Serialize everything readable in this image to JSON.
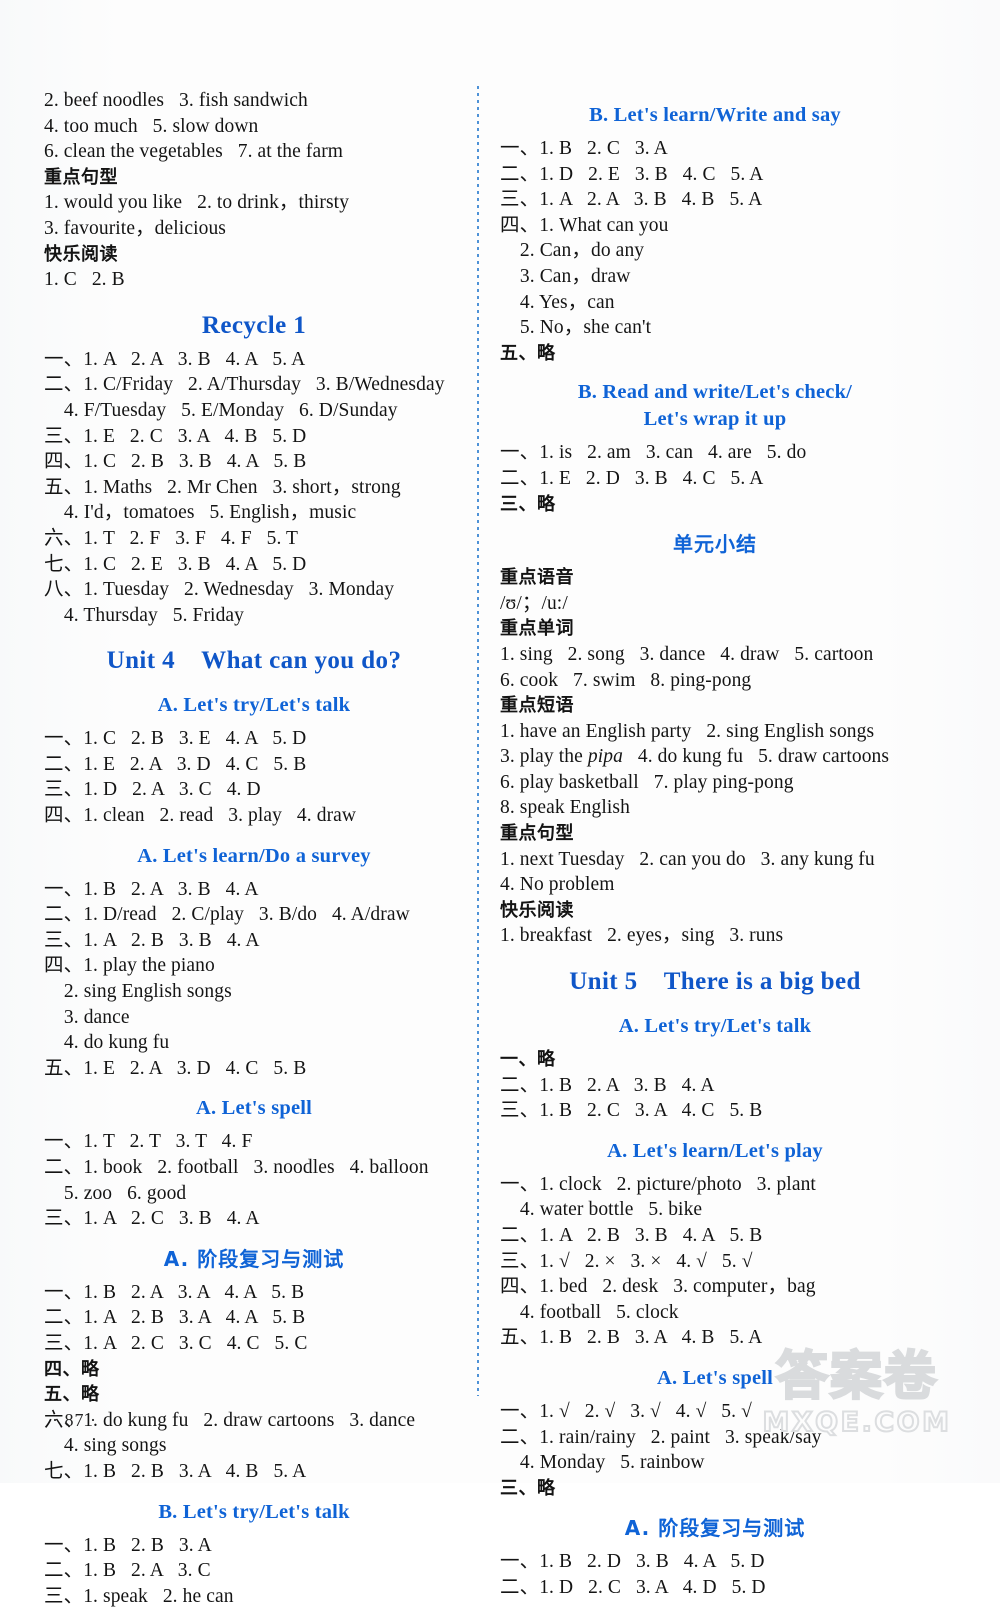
{
  "page": {
    "number": "· 87 ·",
    "watermark_cn": "答案卷",
    "watermark_en": "MXQE.COM"
  },
  "left_column": {
    "blocks": [
      {
        "type": "lines",
        "lines": [
          "2. beef noodles   3. fish sandwich",
          "4. too much   5. slow down",
          "6. clean the vegetables   7. at the farm"
        ]
      },
      {
        "type": "cn-label",
        "text": "重点句型"
      },
      {
        "type": "lines",
        "lines": [
          "1. would you like   2. to drink，thirsty",
          "3. favourite，delicious"
        ]
      },
      {
        "type": "cn-label",
        "text": "快乐阅读"
      },
      {
        "type": "lines",
        "lines": [
          "1. C   2. B"
        ]
      },
      {
        "type": "unit-title",
        "text": "Recycle 1"
      },
      {
        "type": "lines",
        "lines": [
          "一、1. A   2. A   3. B   4. A   5. A",
          "二、1. C/Friday   2. A/Thursday   3. B/Wednesday",
          "    4. F/Tuesday   5. E/Monday   6. D/Sunday",
          "三、1. E   2. C   3. A   4. B   5. D",
          "四、1. C   2. B   3. B   4. A   5. B",
          "五、1. Maths   2. Mr Chen   3. short，strong",
          "    4. I'd，tomatoes   5. English，music",
          "六、1. T   2. F   3. F   4. F   5. T",
          "七、1. C   2. E   3. B   4. A   5. D",
          "八、1. Tuesday   2. Wednesday   3. Monday",
          "    4. Thursday   5. Friday"
        ]
      },
      {
        "type": "unit-title",
        "text": "Unit 4    What can you do?"
      },
      {
        "type": "sec-title",
        "text": "A. Let's try/Let's talk"
      },
      {
        "type": "lines",
        "lines": [
          "一、1. C   2. B   3. E   4. A   5. D",
          "二、1. E   2. A   3. D   4. C   5. B",
          "三、1. D   2. A   3. C   4. D",
          "四、1. clean   2. read   3. play   4. draw"
        ]
      },
      {
        "type": "sec-title",
        "text": "A. Let's learn/Do a survey"
      },
      {
        "type": "lines",
        "lines": [
          "一、1. B   2. A   3. B   4. A",
          "二、1. D/read   2. C/play   3. B/do   4. A/draw",
          "三、1. A   2. B   3. B   4. A",
          "四、1. play the piano",
          "    2. sing English songs",
          "    3. dance",
          "    4. do kung fu",
          "五、1. E   2. A   3. D   4. C   5. B"
        ]
      },
      {
        "type": "sec-title",
        "text": "A. Let's spell"
      },
      {
        "type": "lines",
        "lines": [
          "一、1. T   2. T   3. T   4. F",
          "二、1. book   2. football   3. noodles   4. balloon",
          "    5. zoo   6. good",
          "三、1. A   2. C   3. B   4. A"
        ]
      },
      {
        "type": "sec-title-cn",
        "text": "A. 阶段复习与测试"
      },
      {
        "type": "lines",
        "lines": [
          "一、1. B   2. A   3. A   4. A   5. B",
          "二、1. A   2. B   3. A   4. A   5. B",
          "三、1. A   2. C   3. C   4. C   5. C"
        ]
      },
      {
        "type": "lines-cn",
        "lines": [
          "四、略",
          "五、略"
        ]
      },
      {
        "type": "lines",
        "lines": [
          "六、1. do kung fu   2. draw cartoons   3. dance",
          "    4. sing songs",
          "七、1. B   2. B   3. A   4. B   5. A"
        ]
      },
      {
        "type": "sec-title",
        "text": "B. Let's try/Let's talk"
      },
      {
        "type": "lines",
        "lines": [
          "一、1. B   2. B   3. A",
          "二、1. B   2. A   3. C",
          "三、1. speak   2. he can"
        ]
      }
    ]
  },
  "right_column": {
    "blocks": [
      {
        "type": "sec-title",
        "text": "B. Let's learn/Write and say"
      },
      {
        "type": "lines",
        "lines": [
          "一、1. B   2. C   3. A",
          "二、1. D   2. E   3. B   4. C   5. A",
          "三、1. A   2. A   3. B   4. B   5. A",
          "四、1. What can you",
          "    2. Can，do any",
          "    3. Can，draw",
          "    4. Yes，can",
          "    5. No，she can't"
        ]
      },
      {
        "type": "lines-cn",
        "lines": [
          "五、略"
        ]
      },
      {
        "type": "sec-title",
        "text": "B. Read and write/Let's check/\nLet's wrap it up"
      },
      {
        "type": "lines",
        "lines": [
          "一、1. is   2. am   3. can   4. are   5. do",
          "二、1. E   2. D   3. B   4. C   5. A"
        ]
      },
      {
        "type": "lines-cn",
        "lines": [
          "三、略"
        ]
      },
      {
        "type": "sec-title-cn",
        "text": "单元小结"
      },
      {
        "type": "cn-label",
        "text": "重点语音"
      },
      {
        "type": "lines",
        "lines": [
          "/ʊ/；/u:/"
        ]
      },
      {
        "type": "cn-label",
        "text": "重点单词"
      },
      {
        "type": "lines",
        "lines": [
          "1. sing   2. song   3. dance   4. draw   5. cartoon",
          "6. cook   7. swim   8. ping-pong"
        ]
      },
      {
        "type": "cn-label",
        "text": "重点短语"
      },
      {
        "type": "lines",
        "lines": [
          "1. have an English party   2. sing English songs"
        ]
      },
      {
        "type": "line-italic",
        "pre": "3. play the ",
        "ital": "pipa",
        "post": "   4. do kung fu   5. draw cartoons"
      },
      {
        "type": "lines",
        "lines": [
          "6. play basketball   7. play ping-pong",
          "8. speak English"
        ]
      },
      {
        "type": "cn-label",
        "text": "重点句型"
      },
      {
        "type": "lines",
        "lines": [
          "1. next Tuesday   2. can you do   3. any kung fu",
          "4. No problem"
        ]
      },
      {
        "type": "cn-label",
        "text": "快乐阅读"
      },
      {
        "type": "lines",
        "lines": [
          "1. breakfast   2. eyes，sing   3. runs"
        ]
      },
      {
        "type": "unit-title",
        "text": "Unit 5    There is a big bed"
      },
      {
        "type": "sec-title",
        "text": "A. Let's try/Let's talk"
      },
      {
        "type": "lines-cn",
        "lines": [
          "一、略"
        ]
      },
      {
        "type": "lines",
        "lines": [
          "二、1. B   2. A   3. B   4. A",
          "三、1. B   2. C   3. A   4. C   5. B"
        ]
      },
      {
        "type": "sec-title",
        "text": "A. Let's learn/Let's play"
      },
      {
        "type": "lines",
        "lines": [
          "一、1. clock   2. picture/photo   3. plant",
          "    4. water bottle   5. bike",
          "二、1. A   2. B   3. B   4. A   5. B",
          "三、1. √   2. ×   3. ×   4. √   5. √",
          "四、1. bed   2. desk   3. computer，bag",
          "    4. football   5. clock",
          "五、1. B   2. B   3. A   4. B   5. A"
        ]
      },
      {
        "type": "sec-title",
        "text": "A. Let's spell"
      },
      {
        "type": "lines",
        "lines": [
          "一、1. √   2. √   3. √   4. √   5. √",
          "二、1. rain/rainy   2. paint   3. speak/say",
          "    4. Monday   5. rainbow"
        ]
      },
      {
        "type": "lines-cn",
        "lines": [
          "三、略"
        ]
      },
      {
        "type": "sec-title-cn",
        "text": "A. 阶段复习与测试"
      },
      {
        "type": "lines",
        "lines": [
          "一、1. B   2. D   3. B   4. A   5. D",
          "二、1. D   2. C   3. A   4. D   5. D"
        ]
      }
    ]
  }
}
